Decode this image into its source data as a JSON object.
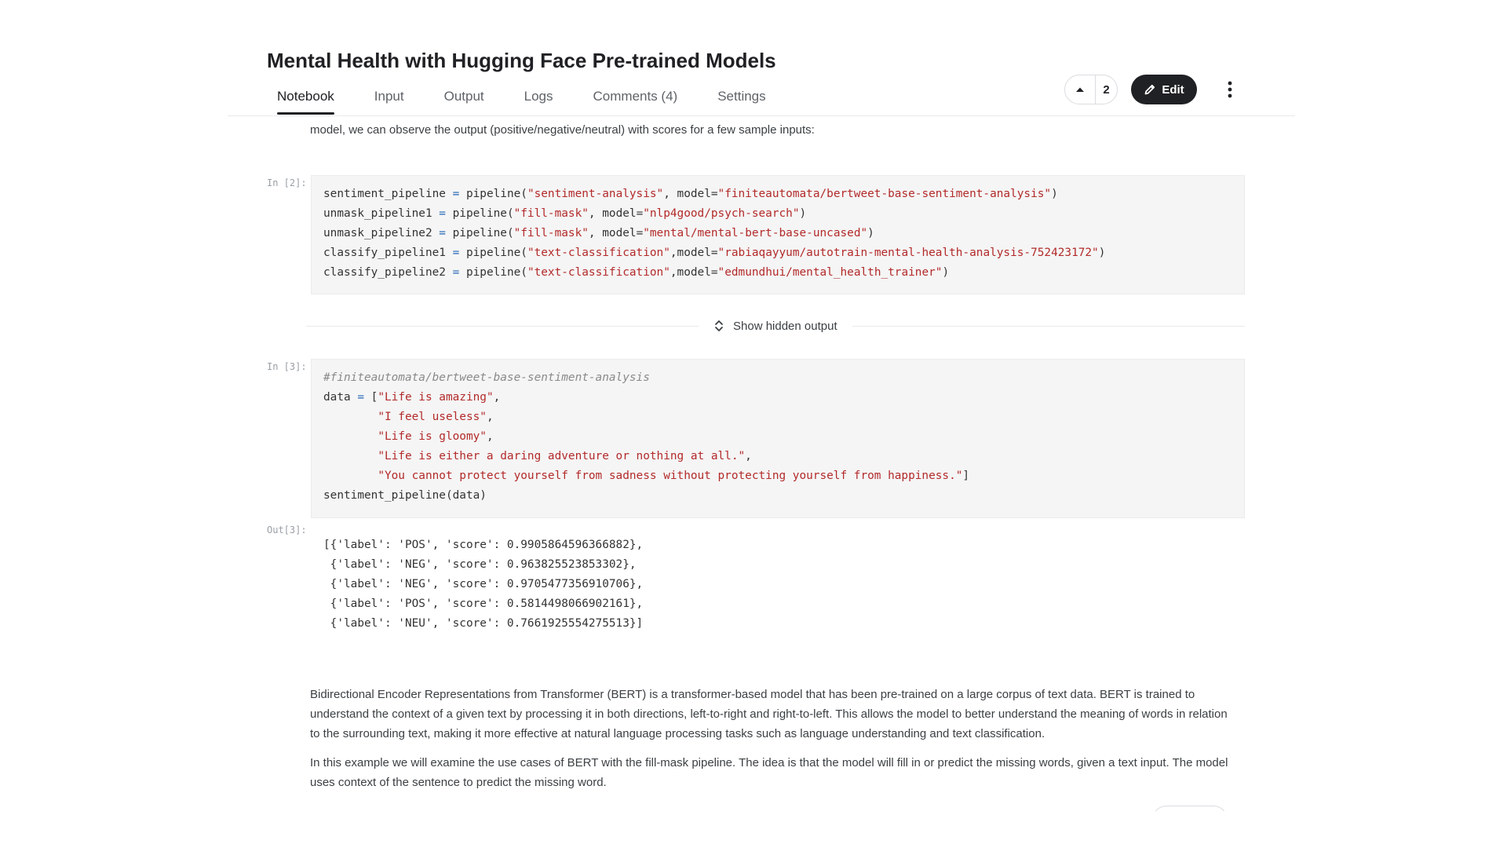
{
  "notebook": {
    "title": "Mental Health with Hugging Face Pre-trained Models",
    "tabs": [
      {
        "label": "Notebook",
        "active": true
      },
      {
        "label": "Input"
      },
      {
        "label": "Output"
      },
      {
        "label": "Logs"
      },
      {
        "label": "Comments (4)"
      },
      {
        "label": "Settings"
      }
    ],
    "vote_count": "2",
    "edit_label": "Edit",
    "icons": {
      "vote": "upvote-icon",
      "edit": "pencil-icon",
      "more": "more-vertical-icon",
      "expand": "expand-icon"
    }
  },
  "cells": {
    "intro_text": "model, we can observe the output (positive/negative/neutral) with scores for a few sample inputs:",
    "cell2": {
      "prompt": "In [2]:",
      "lines": [
        [
          "sentiment_pipeline ",
          "=",
          " pipeline(",
          "\"sentiment-analysis\"",
          ", model=",
          "\"finiteautomata/bertweet-base-sentiment-analysis\"",
          ")"
        ],
        [
          "unmask_pipeline1 ",
          "=",
          " pipeline(",
          "\"fill-mask\"",
          ", model=",
          "\"nlp4good/psych-search\"",
          ")"
        ],
        [
          "unmask_pipeline2 ",
          "=",
          " pipeline(",
          "\"fill-mask\"",
          ", model=",
          "\"mental/mental-bert-base-uncased\"",
          ")"
        ],
        [
          "classify_pipeline1 ",
          "=",
          " pipeline(",
          "\"text-classification\"",
          ",model=",
          "\"rabiaqayyum/autotrain-mental-health-analysis-752423172\"",
          ")"
        ],
        [
          "classify_pipeline2 ",
          "=",
          " pipeline(",
          "\"text-classification\"",
          ",model=",
          "\"edmundhui/mental_health_trainer\"",
          ")"
        ]
      ]
    },
    "hidden_output_label": "Show hidden output",
    "cell3": {
      "prompt": "In [3]:",
      "comment": "#finiteautomata/bertweet-base-sentiment-analysis",
      "data_open": [
        "data ",
        "=",
        " ["
      ],
      "strings": [
        "\"Life is amazing\"",
        "\"I feel useless\"",
        "\"Life is gloomy\"",
        "\"Life is either a daring adventure or nothing at all.\"",
        "\"You cannot protect yourself from sadness without protecting yourself from happiness.\""
      ],
      "call": "sentiment_pipeline(data)",
      "out_prompt": "Out[3]:",
      "output": [
        "[{'label': 'POS', 'score': 0.9905864596366882},",
        " {'label': 'NEG', 'score': 0.963825523853302},",
        " {'label': 'NEG', 'score': 0.9705477356910706},",
        " {'label': 'POS', 'score': 0.5814498066902161},",
        " {'label': 'NEU', 'score': 0.7661925554275513}]"
      ]
    },
    "bert_para1": "Bidirectional Encoder Representations from Transformer (BERT) is a transformer-based model that has been pre-trained on a large corpus of text data. BERT is trained to understand the context of a given text by processing it in both directions, left-to-right and right-to-left. This allows the model to better understand the meaning of words in relation to the surrounding text, making it more effective at natural language processing tasks such as language understanding and text classification.",
    "bert_para2": "In this example we will examine the use cases of BERT with the fill-mask pipeline. The idea is that the model will fill in or predict the missing words, given a text input. The model uses context of the sentence to predict the missing word."
  }
}
